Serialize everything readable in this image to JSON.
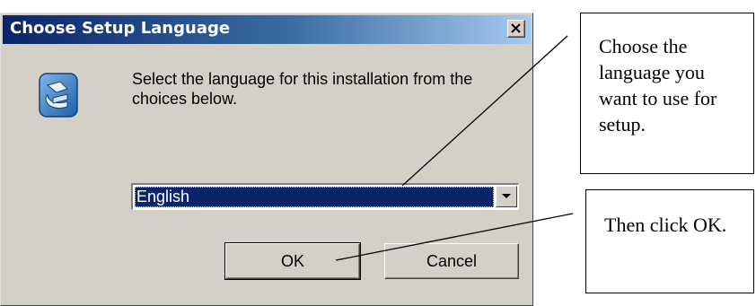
{
  "dialog": {
    "title": "Choose Setup Language",
    "message": "Select the language for this installation from the choices below.",
    "language_select": {
      "selected": "English"
    },
    "buttons": {
      "ok": "OK",
      "cancel": "Cancel"
    },
    "icons": {
      "close": "close-icon",
      "app": "setup-icon",
      "dropdown": "chevron-down-icon"
    }
  },
  "callouts": {
    "choose_language": "Choose the language you want to use for setup.",
    "click_ok": "Then click OK."
  },
  "colors": {
    "titlebar_start": "#0a246a",
    "titlebar_end": "#a6caf0",
    "dialog_face": "#d4d0c8",
    "selection": "#0a246a"
  }
}
